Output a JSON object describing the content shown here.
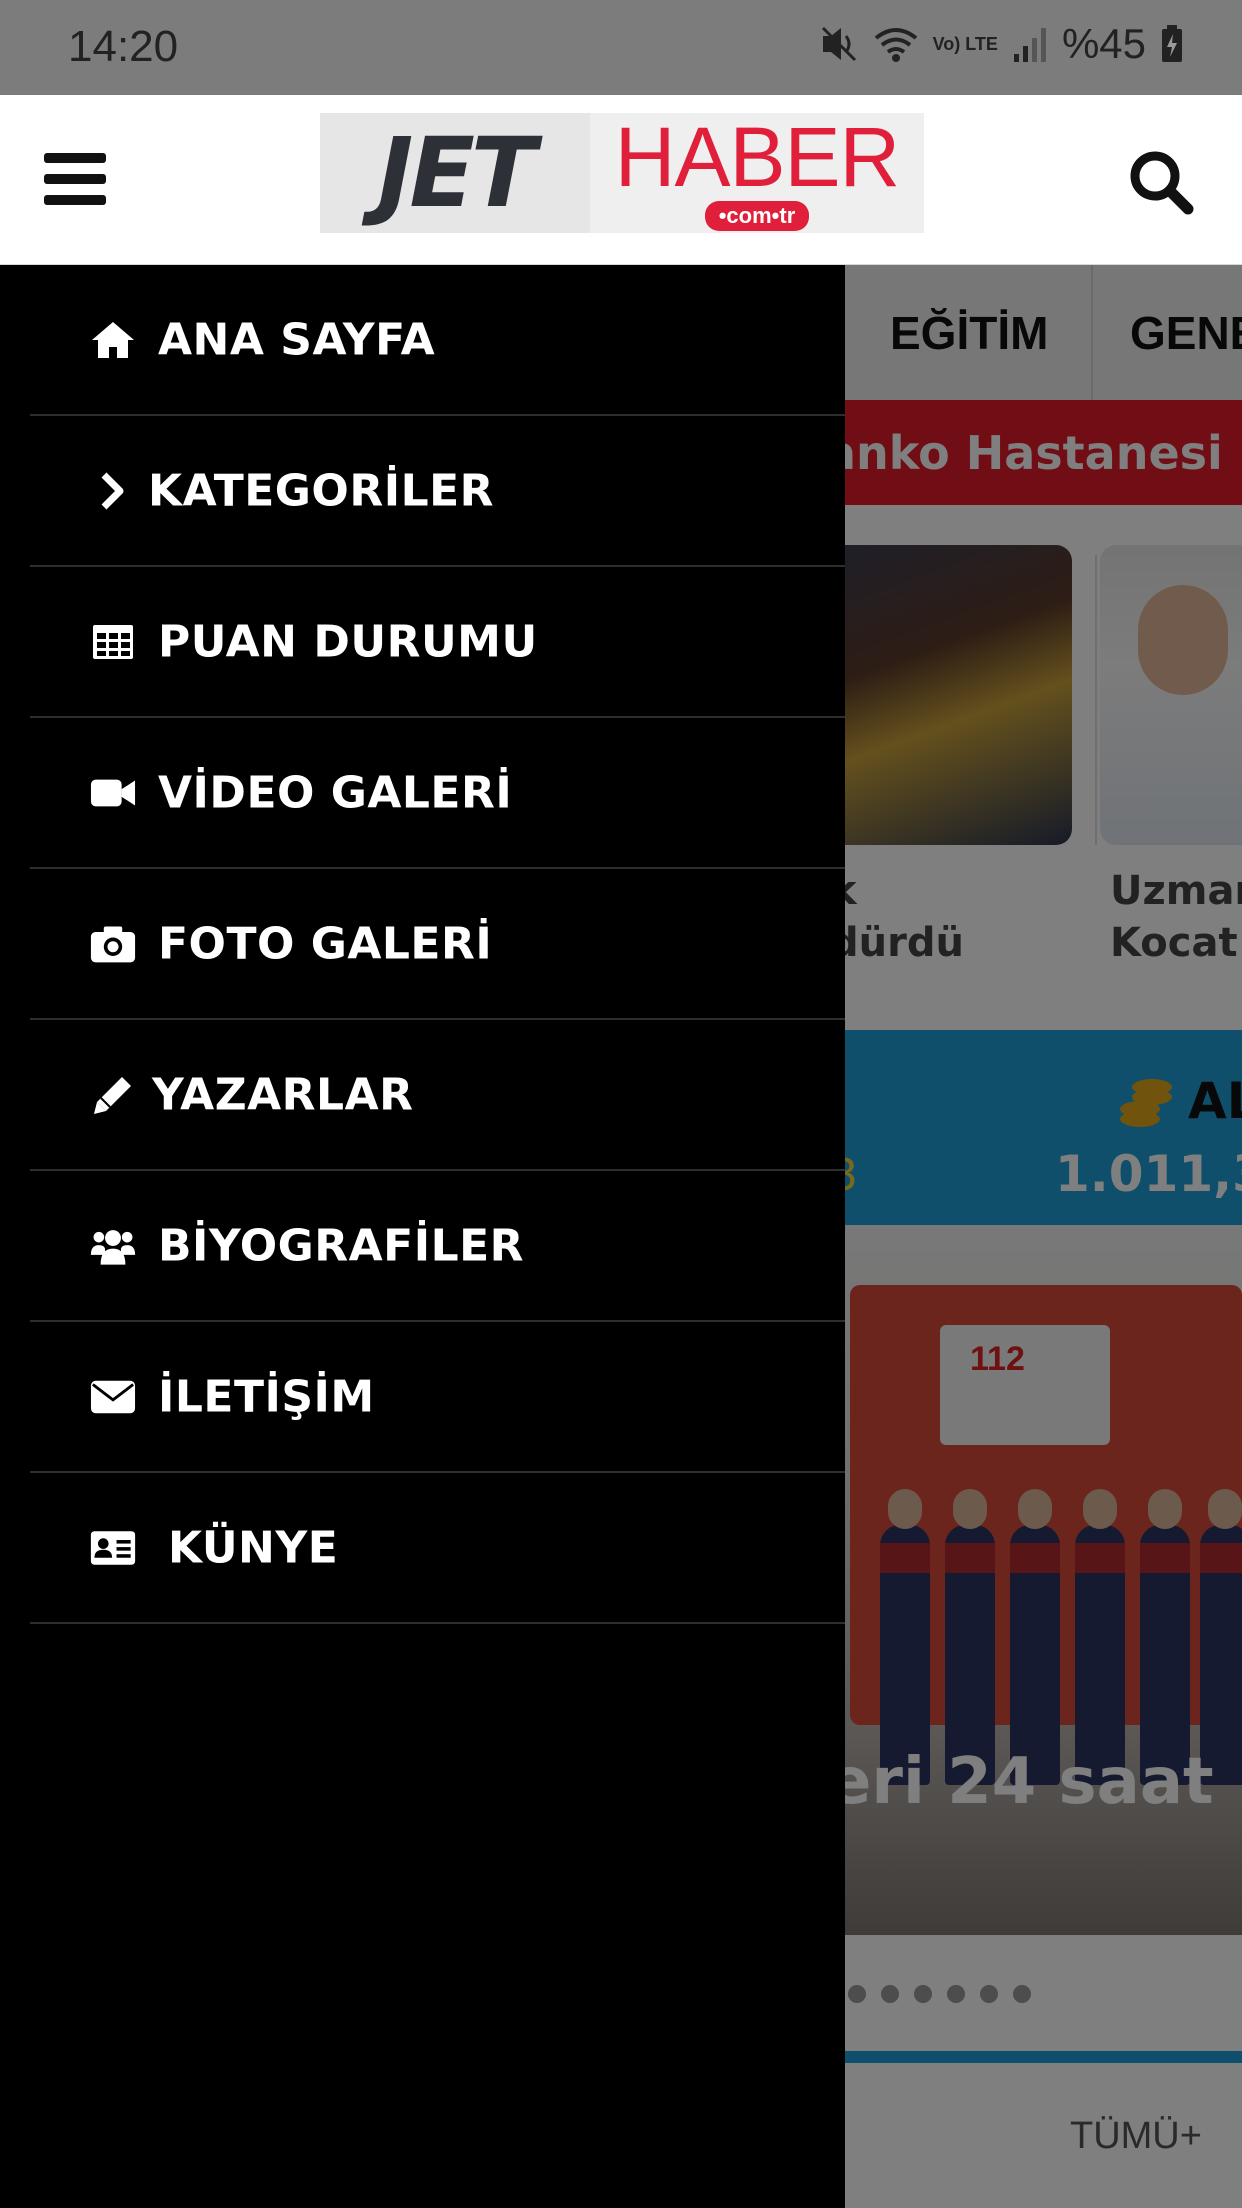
{
  "status_bar": {
    "time": "14:20",
    "battery_percent": "%45",
    "network_label": "Vo) LTE",
    "icons": [
      "mute-icon",
      "wifi-icon",
      "volte-icon",
      "signal-icon",
      "battery-charging-icon"
    ]
  },
  "header": {
    "logo_left": "JET",
    "logo_right": "HABER",
    "logo_domain": "•com•tr",
    "menu_icon": "hamburger-icon",
    "search_icon": "search-icon"
  },
  "background": {
    "categories": [
      "EĞİTİM",
      "GENE"
    ],
    "breaking_text": "anko Hastanesi",
    "cards": [
      {
        "line1": "k",
        "line2": "dürdü"
      },
      {
        "line1": "Uzmar",
        "line2": "Kocat"
      }
    ],
    "finance": {
      "label": "AL",
      "value": "1.011,3",
      "delta": "3"
    },
    "slide_truck_number": "112",
    "slide_caption": "eri 24 saat",
    "all_link": "TÜMÜ+",
    "slide_dot_count": 6
  },
  "drawer": {
    "items": [
      {
        "label": "ANA SAYFA",
        "icon": "home-icon"
      },
      {
        "label": "KATEGORİLER",
        "icon": "chevron-right-icon"
      },
      {
        "label": "PUAN DURUMU",
        "icon": "table-icon"
      },
      {
        "label": "VİDEO GALERİ",
        "icon": "video-camera-icon"
      },
      {
        "label": "FOTO GALERİ",
        "icon": "camera-icon"
      },
      {
        "label": "YAZARLAR",
        "icon": "pencil-icon"
      },
      {
        "label": "BİYOGRAFİLER",
        "icon": "users-icon"
      },
      {
        "label": "İLETİŞİM",
        "icon": "envelope-icon"
      },
      {
        "label": "KÜNYE",
        "icon": "id-card-icon"
      }
    ]
  },
  "colors": {
    "drawer_bg": "#000000",
    "brand_red": "#e0203a",
    "breaking_red": "#e21d2b",
    "finance_blue": "#1e9fd6",
    "status_bar": "#7c7c7c"
  }
}
